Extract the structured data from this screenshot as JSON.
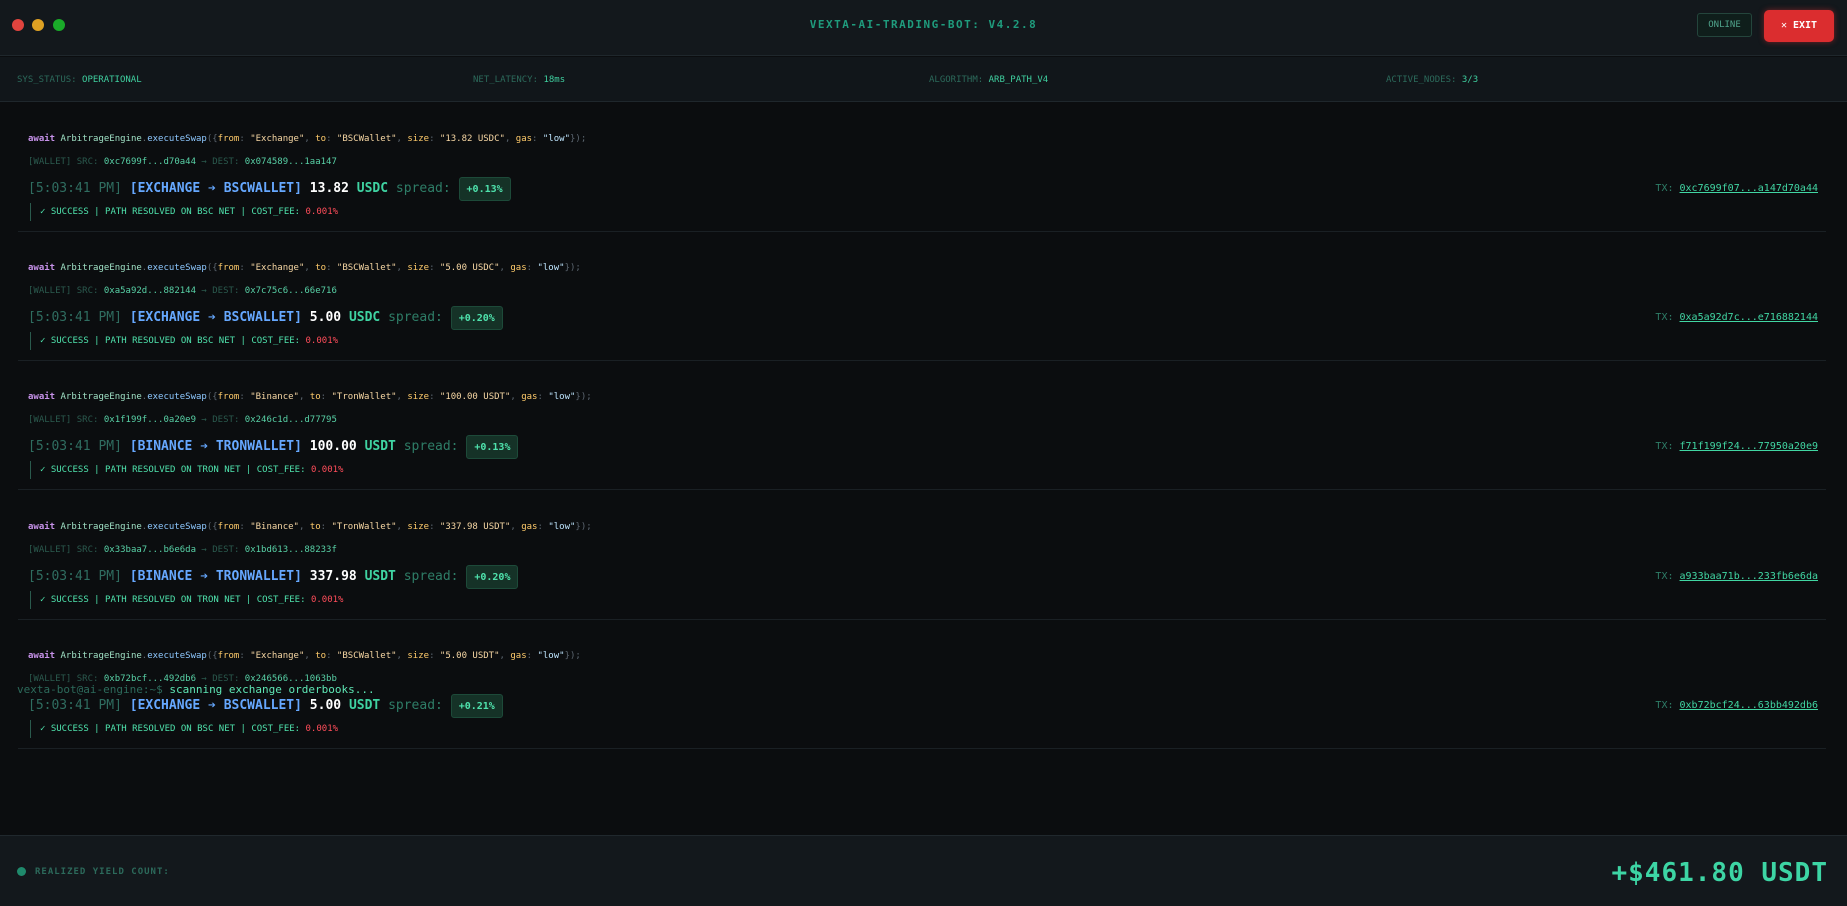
{
  "window": {
    "title": "VEXTA-AI-TRADING-BOT: V4.2.8",
    "status": "ONLINE",
    "exit_label": "EXIT"
  },
  "system": {
    "status": {
      "label": "SYS_STATUS:",
      "value": "OPERATIONAL"
    },
    "latency": {
      "label": "NET_LATENCY:",
      "value": "18ms"
    },
    "algorithm": {
      "label": "ALGORITHM:",
      "value": "ARB_PATH_V4"
    },
    "nodes": {
      "label": "ACTIVE_NODES:",
      "value": "3/3"
    }
  },
  "entries": [
    {
      "code": {
        "await": "await",
        "engine": "ArbitrageEngine",
        "method": "executeSwap",
        "from_key": "from",
        "from_val": "\"Exchange\"",
        "to_key": "to",
        "to_val": "\"BSCWallet\"",
        "size_key": "size",
        "size_val": "\"13.82 USDC\"",
        "gas_key": "gas",
        "gas_val": "\"low\""
      },
      "wallet": {
        "tag": "[WALLET] SRC:",
        "src": "0xc7699f...d70a44",
        "dest_label": "DEST:",
        "dest": "0x074589...1aa147"
      },
      "time": "[5:03:41 PM]",
      "route": {
        "from": "[EXCHANGE",
        "to": "BSCWALLET]"
      },
      "amount": "13.82",
      "token": "USDC",
      "spread_label": "spread:",
      "spread": "+0.13%",
      "tx_label": "TX:",
      "tx": "0xc7699f07...a147d70a44",
      "result": {
        "text": "✓ SUCCESS | PATH RESOLVED ON BSC NET | COST_FEE:",
        "fee": "0.001%"
      }
    },
    {
      "code": {
        "await": "await",
        "engine": "ArbitrageEngine",
        "method": "executeSwap",
        "from_key": "from",
        "from_val": "\"Exchange\"",
        "to_key": "to",
        "to_val": "\"BSCWallet\"",
        "size_key": "size",
        "size_val": "\"5.00 USDC\"",
        "gas_key": "gas",
        "gas_val": "\"low\""
      },
      "wallet": {
        "tag": "[WALLET] SRC:",
        "src": "0xa5a92d...882144",
        "dest_label": "DEST:",
        "dest": "0x7c75c6...66e716"
      },
      "time": "[5:03:41 PM]",
      "route": {
        "from": "[EXCHANGE",
        "to": "BSCWALLET]"
      },
      "amount": "5.00",
      "token": "USDC",
      "spread_label": "spread:",
      "spread": "+0.20%",
      "tx_label": "TX:",
      "tx": "0xa5a92d7c...e716882144",
      "result": {
        "text": "✓ SUCCESS | PATH RESOLVED ON BSC NET | COST_FEE:",
        "fee": "0.001%"
      }
    },
    {
      "code": {
        "await": "await",
        "engine": "ArbitrageEngine",
        "method": "executeSwap",
        "from_key": "from",
        "from_val": "\"Binance\"",
        "to_key": "to",
        "to_val": "\"TronWallet\"",
        "size_key": "size",
        "size_val": "\"100.00 USDT\"",
        "gas_key": "gas",
        "gas_val": "\"low\""
      },
      "wallet": {
        "tag": "[WALLET] SRC:",
        "src": "0x1f199f...0a20e9",
        "dest_label": "DEST:",
        "dest": "0x246c1d...d77795"
      },
      "time": "[5:03:41 PM]",
      "route": {
        "from": "[BINANCE",
        "to": "TRONWALLET]"
      },
      "amount": "100.00",
      "token": "USDT",
      "spread_label": "spread:",
      "spread": "+0.13%",
      "tx_label": "TX:",
      "tx": "f71f199f24...77950a20e9",
      "result": {
        "text": "✓ SUCCESS | PATH RESOLVED ON TRON NET | COST_FEE:",
        "fee": "0.001%"
      }
    },
    {
      "code": {
        "await": "await",
        "engine": "ArbitrageEngine",
        "method": "executeSwap",
        "from_key": "from",
        "from_val": "\"Binance\"",
        "to_key": "to",
        "to_val": "\"TronWallet\"",
        "size_key": "size",
        "size_val": "\"337.98 USDT\"",
        "gas_key": "gas",
        "gas_val": "\"low\""
      },
      "wallet": {
        "tag": "[WALLET] SRC:",
        "src": "0x33baa7...b6e6da",
        "dest_label": "DEST:",
        "dest": "0x1bd613...88233f"
      },
      "time": "[5:03:41 PM]",
      "route": {
        "from": "[BINANCE",
        "to": "TRONWALLET]"
      },
      "amount": "337.98",
      "token": "USDT",
      "spread_label": "spread:",
      "spread": "+0.20%",
      "tx_label": "TX:",
      "tx": "a933baa71b...233fb6e6da",
      "result": {
        "text": "✓ SUCCESS | PATH RESOLVED ON TRON NET | COST_FEE:",
        "fee": "0.001%"
      }
    },
    {
      "code": {
        "await": "await",
        "engine": "ArbitrageEngine",
        "method": "executeSwap",
        "from_key": "from",
        "from_val": "\"Exchange\"",
        "to_key": "to",
        "to_val": "\"BSCWallet\"",
        "size_key": "size",
        "size_val": "\"5.00 USDT\"",
        "gas_key": "gas",
        "gas_val": "\"low\""
      },
      "wallet": {
        "tag": "[WALLET] SRC:",
        "src": "0xb72bcf...492db6",
        "dest_label": "DEST:",
        "dest": "0x246566...1063bb"
      },
      "time": "[5:03:41 PM]",
      "route": {
        "from": "[EXCHANGE",
        "to": "BSCWALLET]"
      },
      "amount": "5.00",
      "token": "USDT",
      "spread_label": "spread:",
      "spread": "+0.21%",
      "tx_label": "TX:",
      "tx": "0xb72bcf24...63bb492db6",
      "result": {
        "text": "✓ SUCCESS | PATH RESOLVED ON BSC NET | COST_FEE:",
        "fee": "0.001%"
      }
    }
  ],
  "prompt": {
    "path": "vexta-bot@ai-engine:~$",
    "command": "scanning exchange orderbooks..."
  },
  "footer": {
    "label": "REALIZED YIELD COUNT:",
    "value": "+$461.80 USDT"
  },
  "icons": {
    "window_close": "red-dot-icon",
    "window_minimize": "yellow-dot-icon",
    "window_maximize": "green-dot-icon",
    "exit": "close-icon",
    "route_arrow": "arrow-right-icon",
    "live": "status-dot-icon"
  },
  "colors": {
    "accent": "#3dd5a4",
    "exit": "#db2d2f",
    "route": "#66a8ff",
    "fee": "#ff4d5a"
  }
}
